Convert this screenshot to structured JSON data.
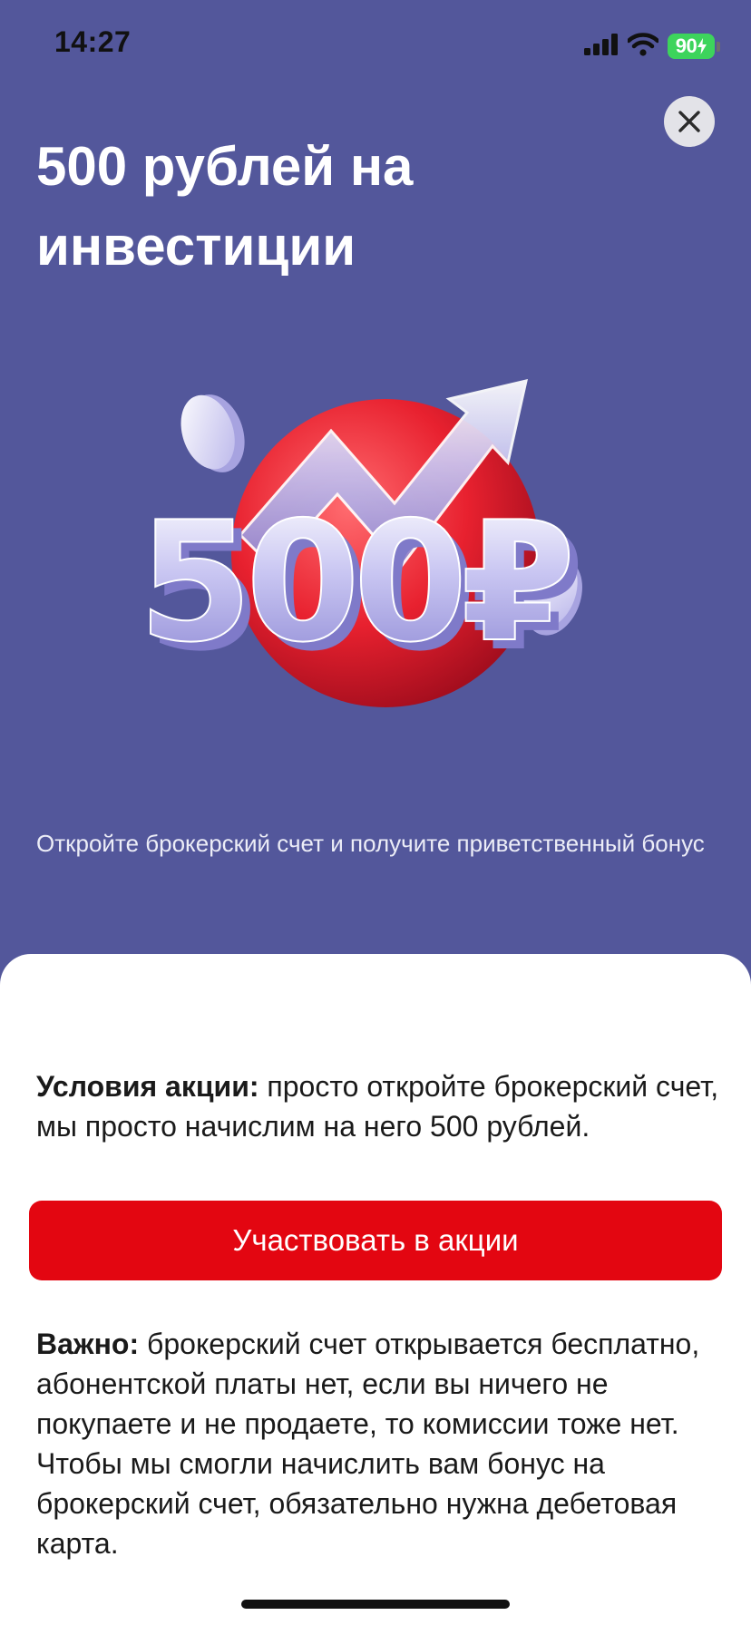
{
  "status_bar": {
    "time": "14:27",
    "battery": "90"
  },
  "promo": {
    "title": "500 рублей на инвестиции",
    "hero_amount": "500₽",
    "subtitle": "Откройте брокерский счет и получите приветственный бонус"
  },
  "sheet": {
    "conditions_label": "Условия акции:",
    "conditions_text": " просто откройте брокерский счет, мы просто начислим на него 500 рублей.",
    "cta_label": "Участвовать в акции",
    "important_label": "Важно:",
    "important_text": " брокерский счет открывается бесплатно, абонентской платы нет, если вы ничего не покупаете и не продаете, то комиссии тоже нет. Чтобы мы смогли начислить вам бонус на брокерский счет, обязательно нужна дебетовая карта."
  },
  "colors": {
    "background": "#53579b",
    "accent_red": "#e30611",
    "sheet": "#ffffff",
    "battery": "#3dd45c"
  },
  "icons": [
    "signal-icon",
    "wifi-icon",
    "battery-icon",
    "charging-bolt-icon",
    "close-icon"
  ]
}
